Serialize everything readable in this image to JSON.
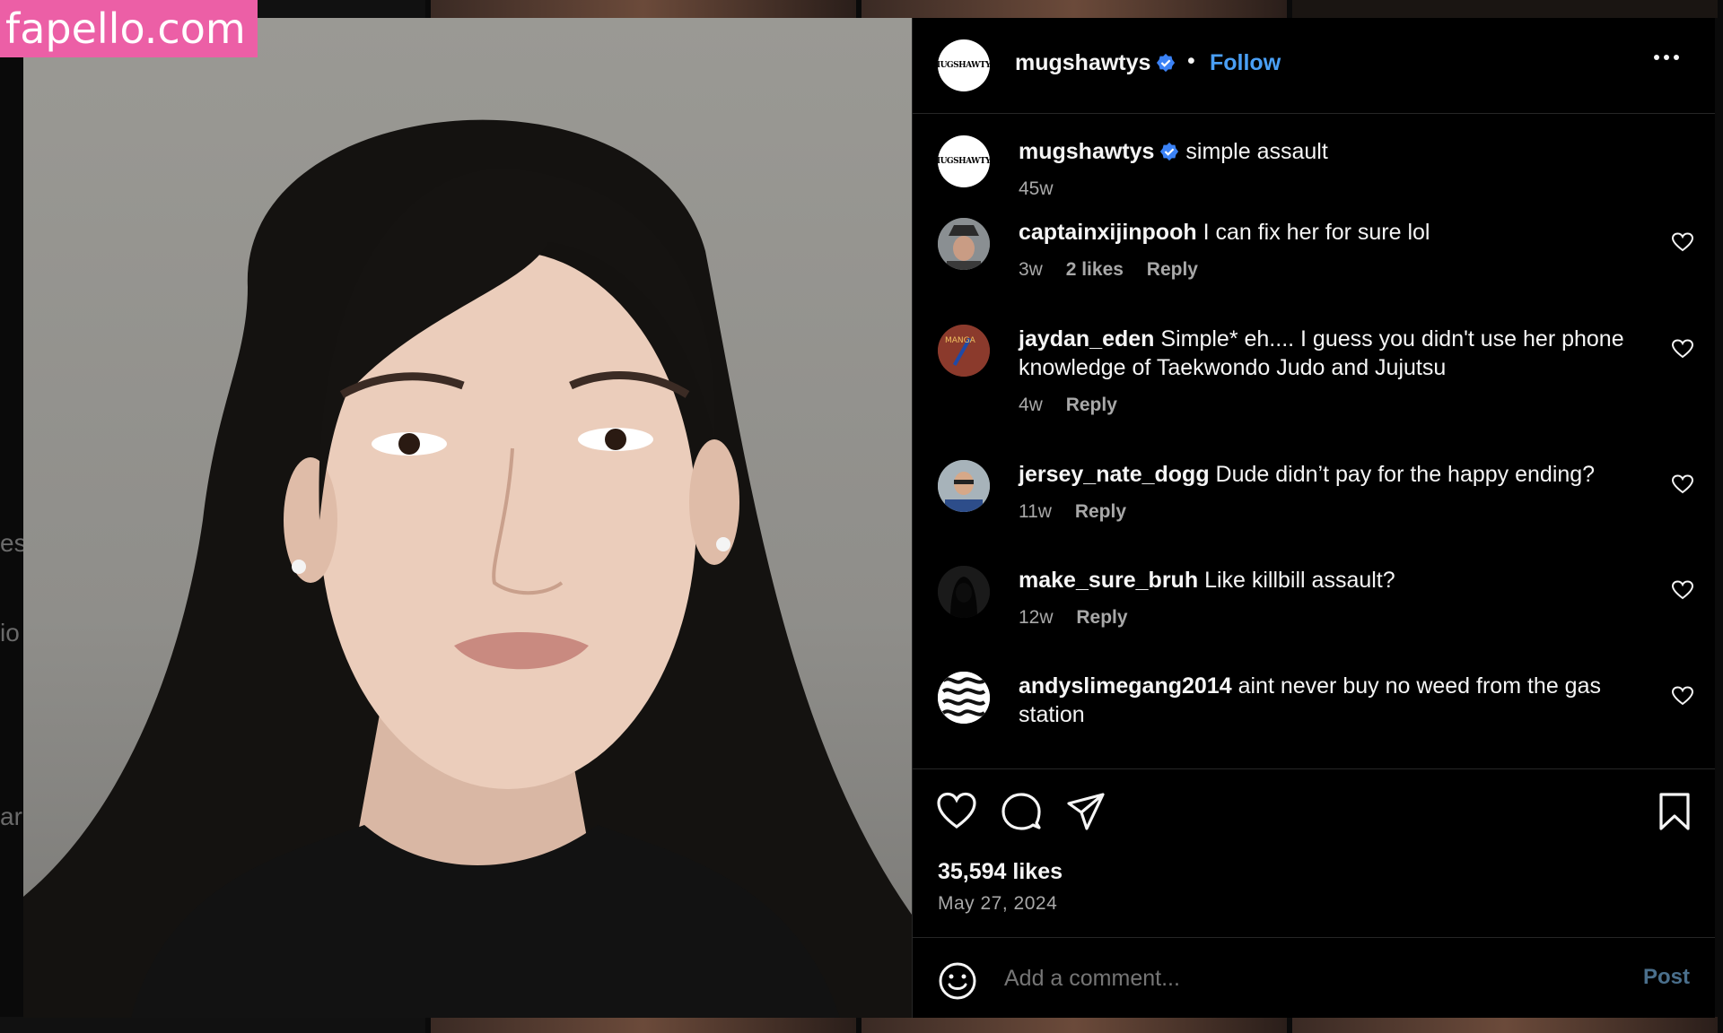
{
  "watermark": "fapello.com",
  "side_fragments": [
    "es",
    "io",
    "ard"
  ],
  "post": {
    "username": "mugshawtys",
    "follow_label": "Follow",
    "dot": "•",
    "avatar_logo": "MUGSHAWTYS",
    "caption": {
      "username": "mugshawtys",
      "text": "simple assault",
      "time": "45w"
    },
    "comments": [
      {
        "username": "captainxijinpooh",
        "text": "I can fix her for sure lol",
        "time": "3w",
        "likes": "2 likes",
        "reply": "Reply"
      },
      {
        "username": "jaydan_eden",
        "text": "Simple* eh.... I guess you didn't use her phone knowledge of Taekwondo Judo and Jujutsu",
        "time": "4w",
        "likes": "",
        "reply": "Reply"
      },
      {
        "username": "jersey_nate_dogg",
        "text": "Dude didn’t pay for the happy ending?",
        "time": "11w",
        "likes": "",
        "reply": "Reply"
      },
      {
        "username": "make_sure_bruh",
        "text": "Like killbill assault?",
        "time": "12w",
        "likes": "",
        "reply": "Reply"
      },
      {
        "username": "andyslimegang2014",
        "text": "aint never buy no weed from the gas station",
        "time": "",
        "likes": "",
        "reply": ""
      }
    ],
    "likes": "35,594 likes",
    "date": "May 27, 2024",
    "add_comment_placeholder": "Add a comment...",
    "post_label": "Post"
  },
  "icons": {
    "more": "more-options-icon",
    "verified": "verified-badge-icon",
    "like": "heart-icon",
    "comment": "comment-icon",
    "share": "share-icon",
    "save": "bookmark-icon",
    "emoji": "emoji-icon"
  },
  "colors": {
    "link": "#4a9ff5",
    "watermark_bg": "#ec5fa6",
    "verified": "#3b82f6"
  }
}
